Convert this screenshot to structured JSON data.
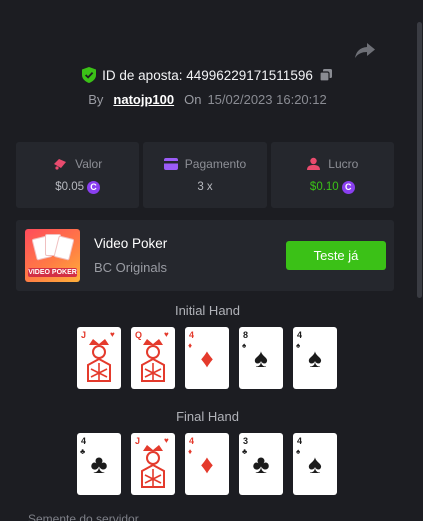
{
  "bet": {
    "id_label": "ID de aposta: 44996229171511596",
    "by_label": "By",
    "username": "natojp100",
    "on_label": "On",
    "datetime": "15/02/2023 16:20:12"
  },
  "stats": [
    {
      "label": "Valor",
      "value": "$0.05",
      "icon": "bet-amount-icon",
      "color": "#e94b6e"
    },
    {
      "label": "Pagamento",
      "value": "3 x",
      "icon": "payout-card-icon",
      "color": "#9b5cf6"
    },
    {
      "label": "Lucro",
      "value": "$0.10",
      "icon": "profit-icon",
      "color": "#e94b6e"
    }
  ],
  "game": {
    "thumb_label": "VIDEO POKER",
    "name": "Video Poker",
    "provider": "BC Originals",
    "try_label": "Teste já"
  },
  "coin_symbol": "C",
  "initial_hand": {
    "title": "Initial Hand",
    "cards": [
      {
        "rank": "J",
        "suit": "♥",
        "color": "red",
        "face": true
      },
      {
        "rank": "Q",
        "suit": "♥",
        "color": "red",
        "face": true
      },
      {
        "rank": "4",
        "suit": "♦",
        "color": "red",
        "face": false
      },
      {
        "rank": "8",
        "suit": "♠",
        "color": "black",
        "face": false
      },
      {
        "rank": "4",
        "suit": "♠",
        "color": "black",
        "face": false
      }
    ]
  },
  "final_hand": {
    "title": "Final Hand",
    "cards": [
      {
        "rank": "4",
        "suit": "♣",
        "color": "black",
        "face": false
      },
      {
        "rank": "J",
        "suit": "♥",
        "color": "red",
        "face": true
      },
      {
        "rank": "4",
        "suit": "♦",
        "color": "red",
        "face": false
      },
      {
        "rank": "3",
        "suit": "♣",
        "color": "black",
        "face": false
      },
      {
        "rank": "4",
        "suit": "♠",
        "color": "black",
        "face": false
      }
    ]
  },
  "footer": {
    "label": "Semente do servidor"
  },
  "colors": {
    "accent_green": "#3bc117",
    "coin_purple": "#8a3ff0",
    "panel": "#25272d",
    "background": "#1c1d22"
  }
}
